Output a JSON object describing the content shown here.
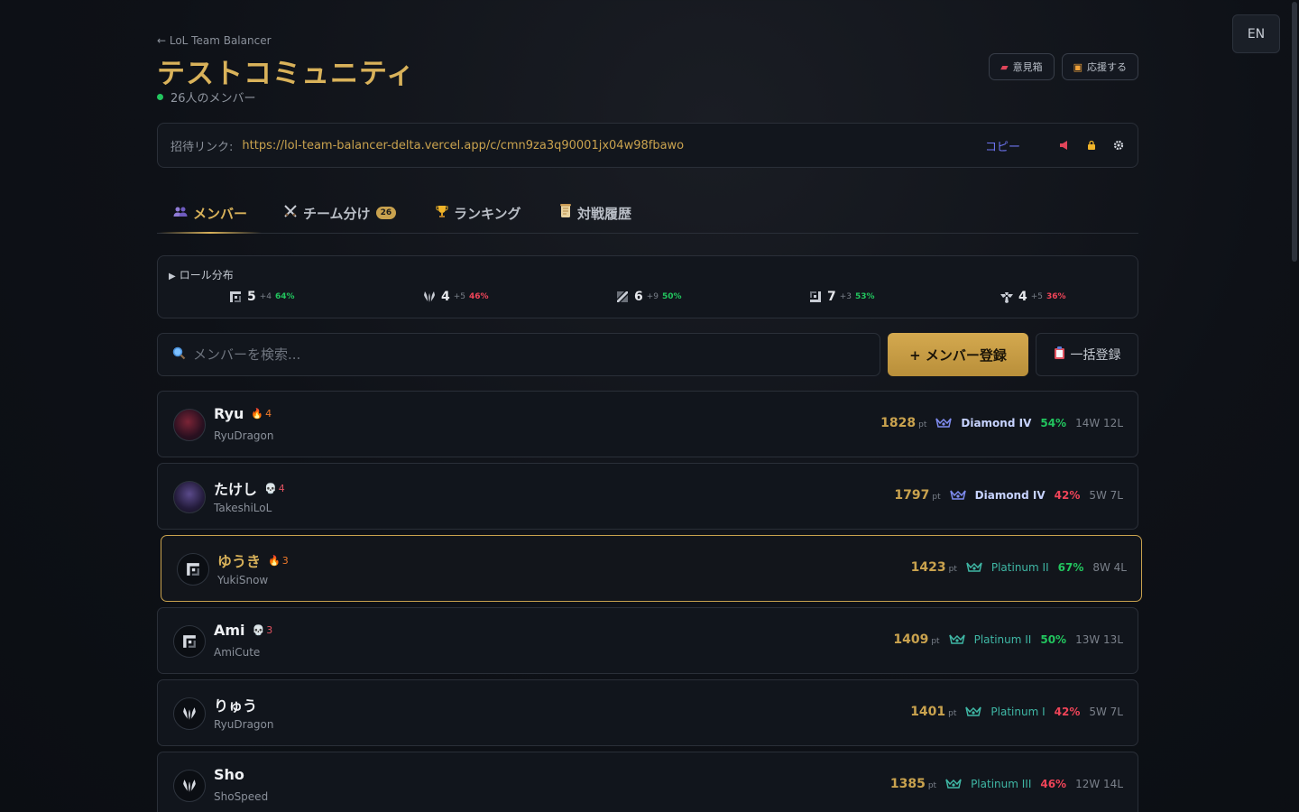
{
  "lang_button": "EN",
  "header": {
    "back_link": "← LoL Team Balancer",
    "title": "テストコミュニティ",
    "member_count": "26人のメンバー",
    "actions": [
      {
        "label": "意見箱",
        "icon": "ticket-icon"
      },
      {
        "label": "応援する",
        "icon": "gift-icon"
      }
    ]
  },
  "invite": {
    "label": "招待リンク:",
    "url": "https://lol-team-balancer-delta.vercel.app/c/cmn9za3q90001jx04w98fbawo",
    "copy_label": "コピー",
    "icons": [
      "megaphone-icon",
      "lock-icon",
      "gear-icon"
    ]
  },
  "tabs": [
    {
      "label": "メンバー",
      "icon": "people-icon",
      "active": true
    },
    {
      "label": "チーム分け",
      "icon": "crossed-swords-icon",
      "badge": "26"
    },
    {
      "label": "ランキング",
      "icon": "trophy-icon"
    },
    {
      "label": "対戦履歴",
      "icon": "scroll-icon"
    }
  ],
  "roles": {
    "header": "ロール分布",
    "items": [
      {
        "role": "top",
        "count": "5",
        "plus": "+4",
        "pct": "64%",
        "pct_color": "#22c55e"
      },
      {
        "role": "jungle",
        "count": "4",
        "plus": "+5",
        "pct": "46%",
        "pct_color": "#ef4458"
      },
      {
        "role": "mid",
        "count": "6",
        "plus": "+9",
        "pct": "50%",
        "pct_color": "#22c55e"
      },
      {
        "role": "bot",
        "count": "7",
        "plus": "+3",
        "pct": "53%",
        "pct_color": "#22c55e"
      },
      {
        "role": "support",
        "count": "4",
        "plus": "+5",
        "pct": "36%",
        "pct_color": "#ef4458"
      }
    ]
  },
  "search": {
    "placeholder": "メンバーを検索..."
  },
  "add_button": "+ メンバー登録",
  "bulk_button": "一括登録",
  "members": [
    {
      "name": "Ryu",
      "id": "RyuDragon",
      "streak": "4",
      "streak_type": "win",
      "pt": "1828",
      "pt_unit": "pt",
      "tier": "Diamond IV",
      "tier_type": "diamond",
      "wr": "54%",
      "wr_type": "good",
      "wl": "14W 12L",
      "avatar": "champion-portrait"
    },
    {
      "name": "たけし",
      "id": "TakeshiLoL",
      "streak": "4",
      "streak_type": "lose",
      "pt": "1797",
      "pt_unit": "pt",
      "tier": "Diamond IV",
      "tier_type": "diamond",
      "wr": "42%",
      "wr_type": "bad",
      "wl": "5W 7L",
      "avatar": "champion-portrait"
    },
    {
      "name": "ゆうき",
      "id": "YukiSnow",
      "streak": "3",
      "streak_type": "win",
      "pt": "1423",
      "pt_unit": "pt",
      "tier": "Platinum II",
      "tier_type": "platinum",
      "wr": "67%",
      "wr_type": "good",
      "wl": "8W 4L",
      "avatar": "top-role-icon",
      "highlight": true
    },
    {
      "name": "Ami",
      "id": "AmiCute",
      "streak": "3",
      "streak_type": "lose",
      "pt": "1409",
      "pt_unit": "pt",
      "tier": "Platinum II",
      "tier_type": "platinum",
      "wr": "50%",
      "wr_type": "good",
      "wl": "13W 13L",
      "avatar": "top-role-icon"
    },
    {
      "name": "りゅう",
      "id": "RyuDragon",
      "streak": "",
      "streak_type": "",
      "pt": "1401",
      "pt_unit": "pt",
      "tier": "Platinum I",
      "tier_type": "platinum",
      "wr": "42%",
      "wr_type": "bad",
      "wl": "5W 7L",
      "avatar": "jungle-role-icon"
    },
    {
      "name": "Sho",
      "id": "ShoSpeed",
      "streak": "",
      "streak_type": "",
      "pt": "1385",
      "pt_unit": "pt",
      "tier": "Platinum III",
      "tier_type": "platinum",
      "wr": "46%",
      "wr_type": "bad",
      "wl": "12W 14L",
      "avatar": "jungle-role-icon"
    }
  ]
}
